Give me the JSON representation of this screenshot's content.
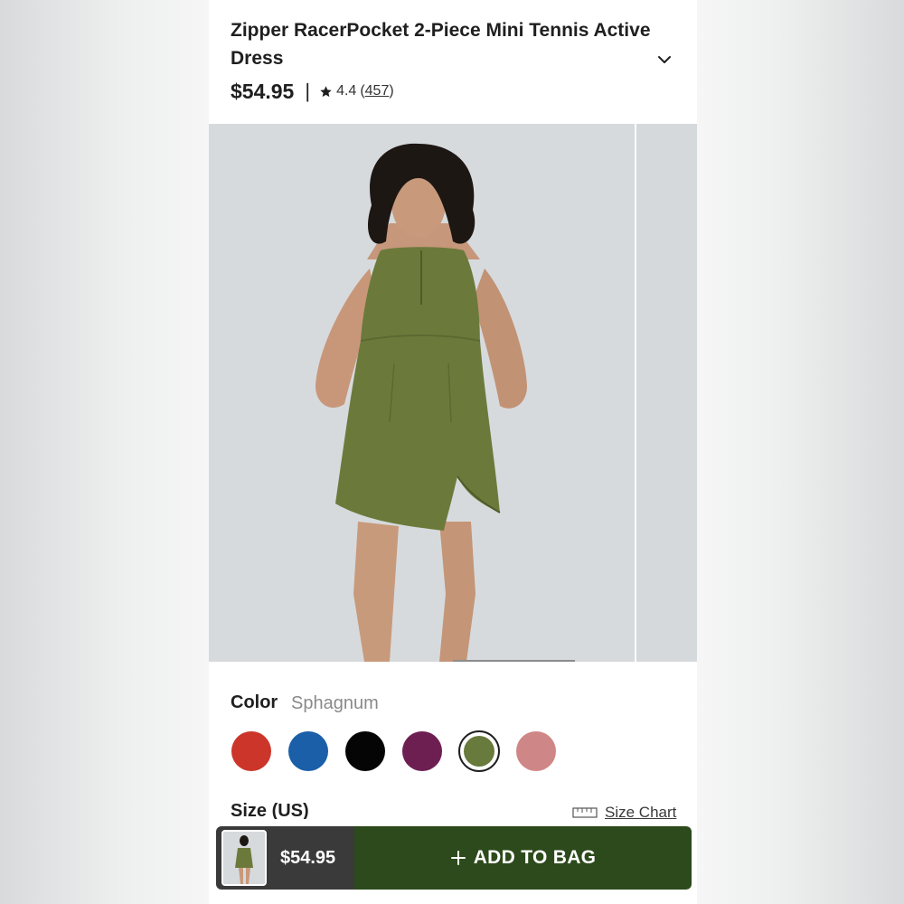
{
  "product": {
    "title": "Zipper RacerPocket 2-Piece Mini Tennis Active Dress",
    "price": "$54.95",
    "price_separator": "|",
    "rating": "4.4",
    "reviews_count": "457",
    "chevron_icon": "chevron-down-icon",
    "star_icon": "star-icon"
  },
  "gallery": {
    "image_icon": "product-photo",
    "active_index": 0
  },
  "color": {
    "label": "Color",
    "selected_name": "Sphagnum",
    "swatches": [
      {
        "hex": "#cc3529",
        "selected": false
      },
      {
        "hex": "#1a5fa8",
        "selected": false
      },
      {
        "hex": "#050505",
        "selected": false
      },
      {
        "hex": "#6d1f52",
        "selected": false
      },
      {
        "hex": "#687a3c",
        "selected": true
      },
      {
        "hex": "#cf8686",
        "selected": false
      }
    ]
  },
  "size": {
    "label": "Size (US)",
    "chart_label": "Size Chart",
    "chart_icon": "ruler-icon"
  },
  "bottom_bar": {
    "price": "$54.95",
    "add_to_bag_label": "ADD TO BAG",
    "plus_icon": "plus-icon",
    "button_color": "#2c4a1b"
  }
}
